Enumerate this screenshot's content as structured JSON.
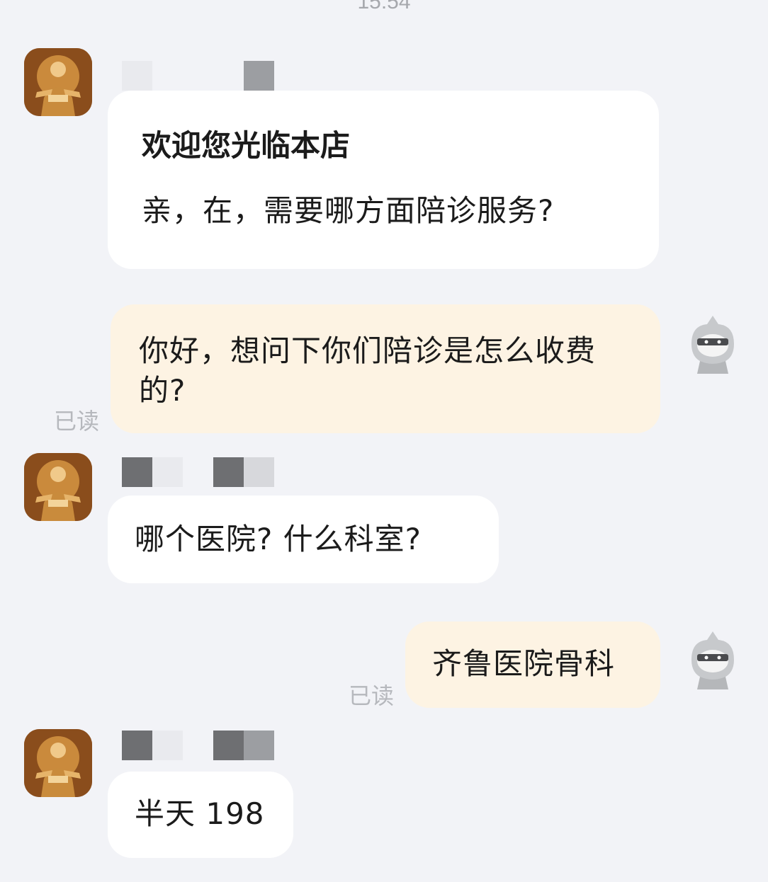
{
  "chat": {
    "timestamp": "15:54",
    "messages": [
      {
        "side": "left",
        "title": "欢迎您光临本店",
        "text": "亲，在，需要哪方面陪诊服务?"
      },
      {
        "side": "right",
        "text": "你好，想问下你们陪诊是怎么收费的?",
        "status": "已读"
      },
      {
        "side": "left",
        "text": "哪个医院? 什么科室?"
      },
      {
        "side": "right",
        "text": "齐鲁医院骨科",
        "status": "已读"
      },
      {
        "side": "left",
        "text": "半天 198"
      }
    ]
  },
  "icons": {
    "shop_avatar": "warrior-statue-avatar",
    "user_avatar": "ninja-cartoon-avatar"
  },
  "colors": {
    "background": "#f2f3f7",
    "incoming_bubble": "#ffffff",
    "outgoing_bubble": "#fdf3e3",
    "read_status": "#b6b8bd"
  }
}
